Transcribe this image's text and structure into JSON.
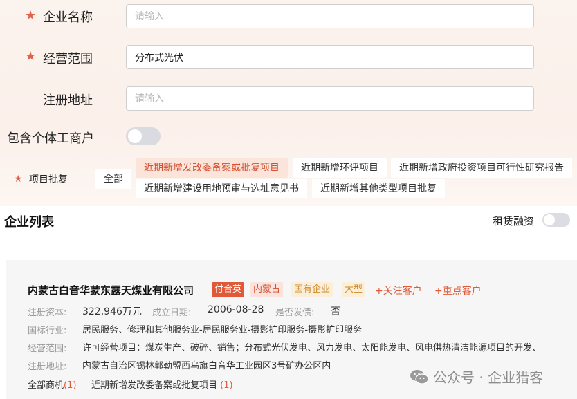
{
  "form": {
    "company_name": {
      "label": "企业名称",
      "placeholder": "请输入",
      "value": ""
    },
    "business_scope": {
      "label": "经营范围",
      "value": "分布式光伏"
    },
    "reg_address": {
      "label": "注册地址",
      "placeholder": "请输入",
      "value": ""
    },
    "include_individual": {
      "label": "包含个体工商户",
      "on": false
    },
    "project_approval": {
      "label": "项目批复",
      "options": [
        "全部",
        "近期新增发改委备案或批复项目",
        "近期新增环评项目",
        "近期新增政府投资项目可行性研究报告",
        "近期新增建设用地预审与选址意见书",
        "近期新增其他类型项目批复"
      ],
      "selected": "近期新增发改委备案或批复项目"
    }
  },
  "list": {
    "title": "企业列表",
    "lease_finance": {
      "label": "租赁融资",
      "on": false
    }
  },
  "company": {
    "name": "内蒙古白音华蒙东露天煤业有限公司",
    "tags": {
      "legal_rep": "付合英",
      "region": "内蒙古",
      "type": "国有企业",
      "size": "大型"
    },
    "actions": {
      "follow": "+关注客户",
      "key": "+重点客户"
    },
    "capital_label": "注册资本:",
    "capital": "322,946万元",
    "founded_label": "成立日期:",
    "founded": "2006-08-28",
    "bond_label": "是否发债:",
    "bond": "否",
    "industry_label": "国标行业:",
    "industry": "居民服务、修理和其他服务业-居民服务业-摄影扩印服务-摄影扩印服务",
    "scope_label": "经营范围:",
    "scope": "许可经营项目：煤炭生产、破碎、销售；分布式光伏发电、风力发电、太阳能发电、风电供热清洁能源项目的开发、",
    "address_label": "注册地址:",
    "address": "内蒙古自治区锡林郭勒盟西乌旗白音华工业园区3号矿办公区内",
    "opportunities": {
      "label": "全部商机",
      "count": "1"
    },
    "projects": {
      "label": "近期新增发改委备案或批复项目",
      "count": "1"
    }
  },
  "watermark": "公众号 · 企业猎客",
  "colors": {
    "accent": "#e05a38",
    "panel_bg": "#fbf3ee"
  },
  "icons": [
    "star-icon",
    "wechat-icon"
  ]
}
